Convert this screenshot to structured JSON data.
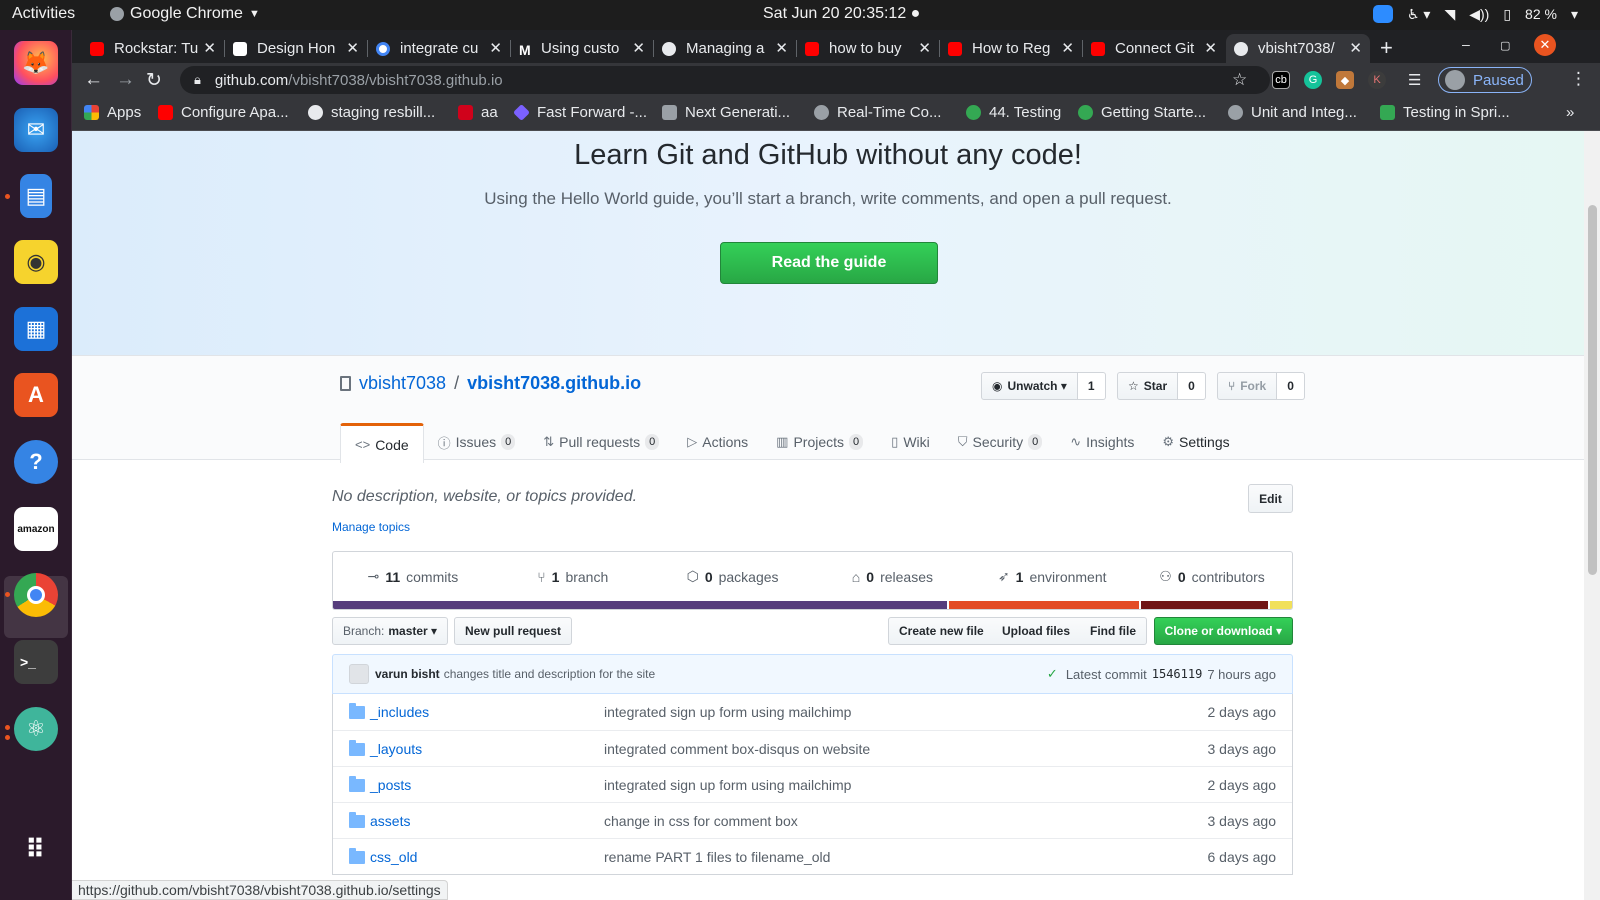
{
  "system": {
    "activities": "Activities",
    "app_name": "Google Chrome",
    "clock": "Sat Jun 20  20:35:12 ●",
    "battery": "82 %"
  },
  "tabs": [
    {
      "title": "Rockstar: Tu",
      "color": "#ff0000"
    },
    {
      "title": "Design Hon",
      "color": "#ffffff"
    },
    {
      "title": "integrate cu",
      "color": "#4285f4"
    },
    {
      "title": "Using custo",
      "color": "#ffffff"
    },
    {
      "title": "Managing a",
      "color": "#ffffff"
    },
    {
      "title": "how to buy",
      "color": "#ff0000"
    },
    {
      "title": "How to Reg",
      "color": "#ff0000"
    },
    {
      "title": "Connect Git",
      "color": "#ff0000"
    },
    {
      "title": "vbisht7038/",
      "color": "#ffffff"
    }
  ],
  "omnibox": {
    "host": "github.com",
    "path": "/vbisht7038/vbisht7038.github.io",
    "profile_status": "Paused"
  },
  "bookmarks": [
    {
      "label": "Apps",
      "color": "#ea4335"
    },
    {
      "label": "Configure Apa...",
      "color": "#ff0000"
    },
    {
      "label": "staging resbill...",
      "color": "#e8eaed"
    },
    {
      "label": "aa",
      "color": "#d0021b"
    },
    {
      "label": "Fast Forward -...",
      "color": "#7b61ff"
    },
    {
      "label": "Next Generati...",
      "color": "#9aa0a6"
    },
    {
      "label": "Real-Time Co...",
      "color": "#9aa0a6"
    },
    {
      "label": "44. Testing",
      "color": "#34a853"
    },
    {
      "label": "Getting Starte...",
      "color": "#34a853"
    },
    {
      "label": "Unit and Integ...",
      "color": "#9aa0a6"
    },
    {
      "label": "Testing in Spri...",
      "color": "#34a853"
    }
  ],
  "hero": {
    "title": "Learn Git and GitHub without any code!",
    "subtitle": "Using the Hello World guide, you’ll start a branch, write comments, and open a pull request.",
    "cta": "Read the guide"
  },
  "repo": {
    "owner": "vbisht7038",
    "separator": "/",
    "name": "vbisht7038.github.io",
    "unwatch_label": "Unwatch ▾",
    "watch_count": "1",
    "star_label": "Star",
    "star_count": "0",
    "fork_label": "Fork",
    "fork_count": "0"
  },
  "reponav": [
    {
      "label": "Code",
      "icon": "<>",
      "count": ""
    },
    {
      "label": "Issues",
      "icon": "ⓘ",
      "count": "0"
    },
    {
      "label": "Pull requests",
      "icon": "⇅",
      "count": "0"
    },
    {
      "label": "Actions",
      "icon": "▷",
      "count": ""
    },
    {
      "label": "Projects",
      "icon": "▥",
      "count": "0"
    },
    {
      "label": "Wiki",
      "icon": "▯",
      "count": ""
    },
    {
      "label": "Security",
      "icon": "⛉",
      "count": "0"
    },
    {
      "label": "Insights",
      "icon": "∿",
      "count": ""
    },
    {
      "label": "Settings",
      "icon": "⚙",
      "count": ""
    }
  ],
  "about": {
    "description": "No description, website, or topics provided.",
    "manage_topics": "Manage topics",
    "edit": "Edit"
  },
  "summary": [
    {
      "num": "11",
      "label": "commits",
      "icon": "⊸"
    },
    {
      "num": "1",
      "label": "branch",
      "icon": "⑂"
    },
    {
      "num": "0",
      "label": "packages",
      "icon": "⬡"
    },
    {
      "num": "0",
      "label": "releases",
      "icon": "⌂"
    },
    {
      "num": "1",
      "label": "environment",
      "icon": "➶"
    },
    {
      "num": "0",
      "label": "contributors",
      "icon": "⚇"
    }
  ],
  "languages": [
    {
      "color": "#563d7c",
      "share": 0.64
    },
    {
      "color": "#e34c26",
      "share": 0.2
    },
    {
      "color": "#701516",
      "share": 0.135
    },
    {
      "color": "#f1e05a",
      "share": 0.025
    }
  ],
  "filenav": {
    "branch_prefix": "Branch:",
    "branch": "master ▾",
    "new_pr": "New pull request",
    "create": "Create new file",
    "upload": "Upload files",
    "find": "Find file",
    "clone": "Clone or download ▾"
  },
  "commit": {
    "author": "varun bisht",
    "message": "changes title and description for the site",
    "latest_label": "Latest commit",
    "sha": "1546119",
    "age": "7 hours ago"
  },
  "files": [
    {
      "name": "_includes",
      "message": "integrated sign up form using mailchimp",
      "age": "2 days ago"
    },
    {
      "name": "_layouts",
      "message": "integrated comment box-disqus on website",
      "age": "3 days ago"
    },
    {
      "name": "_posts",
      "message": "integrated sign up form using mailchimp",
      "age": "2 days ago"
    },
    {
      "name": "assets",
      "message": "change in css for comment box",
      "age": "3 days ago"
    },
    {
      "name": "css_old",
      "message": "rename PART 1 files to filename_old",
      "age": "6 days ago"
    }
  ],
  "status_url": "https://github.com/vbisht7038/vbisht7038.github.io/settings"
}
